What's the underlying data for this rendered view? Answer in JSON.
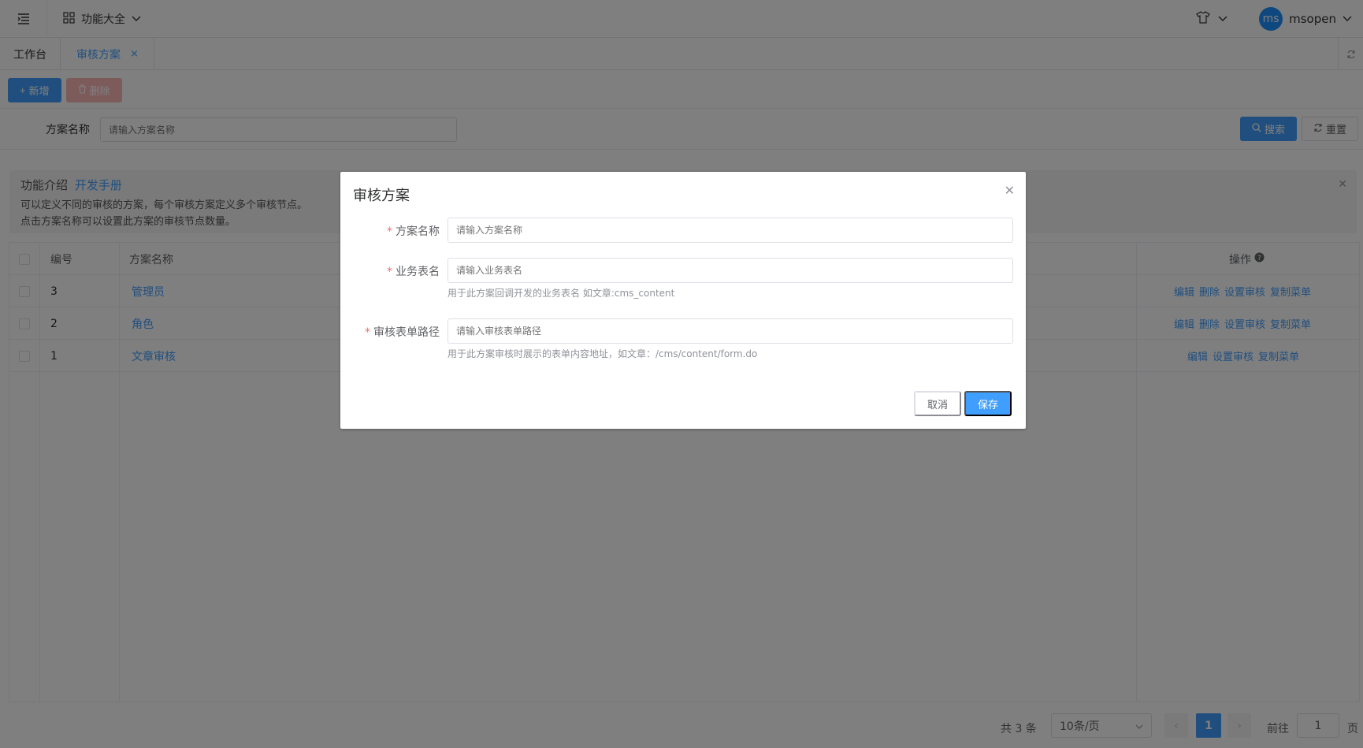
{
  "header": {
    "func_all": "功能大全",
    "avatar_text": "ms",
    "username": "msopen"
  },
  "tabs": [
    {
      "label": "工作台"
    },
    {
      "label": "审核方案",
      "close": "×"
    }
  ],
  "toolbar": {
    "add": "新增",
    "delete": "删除"
  },
  "filter": {
    "label": "方案名称",
    "placeholder": "请输入方案名称",
    "search": "搜索",
    "reset": "重置"
  },
  "intro": {
    "title": "功能介绍",
    "link": "开发手册",
    "line1": "可以定义不同的审核的方案，每个审核方案定义多个审核节点。",
    "line2": "点击方案名称可以设置此方案的审核节点数量。"
  },
  "table": {
    "headers": {
      "id": "编号",
      "name": "方案名称",
      "ops": "操作"
    },
    "rows": [
      {
        "id": "3",
        "name": "管理员",
        "ops": [
          "编辑",
          "删除",
          "设置审核",
          "复制菜单"
        ]
      },
      {
        "id": "2",
        "name": "角色",
        "ops": [
          "编辑",
          "删除",
          "设置审核",
          "复制菜单"
        ]
      },
      {
        "id": "1",
        "name": "文章审核",
        "ops": [
          "编辑",
          "设置审核",
          "复制菜单"
        ]
      }
    ]
  },
  "pager": {
    "total": "共 3 条",
    "size": "10条/页",
    "current": "1",
    "goto": "前往",
    "goto_value": "1",
    "suffix": "页"
  },
  "dialog": {
    "title": "审核方案",
    "fields": [
      {
        "label": "方案名称",
        "placeholder": "请输入方案名称",
        "hint": ""
      },
      {
        "label": "业务表名",
        "placeholder": "请输入业务表名",
        "hint": "用于此方案回调开发的业务表名 如文章:cms_content"
      },
      {
        "label": "审核表单路径",
        "placeholder": "请输入审核表单路径",
        "hint": "用于此方案审核时展示的表单内容地址，如文章：/cms/content/form.do"
      }
    ],
    "cancel": "取消",
    "save": "保存"
  }
}
